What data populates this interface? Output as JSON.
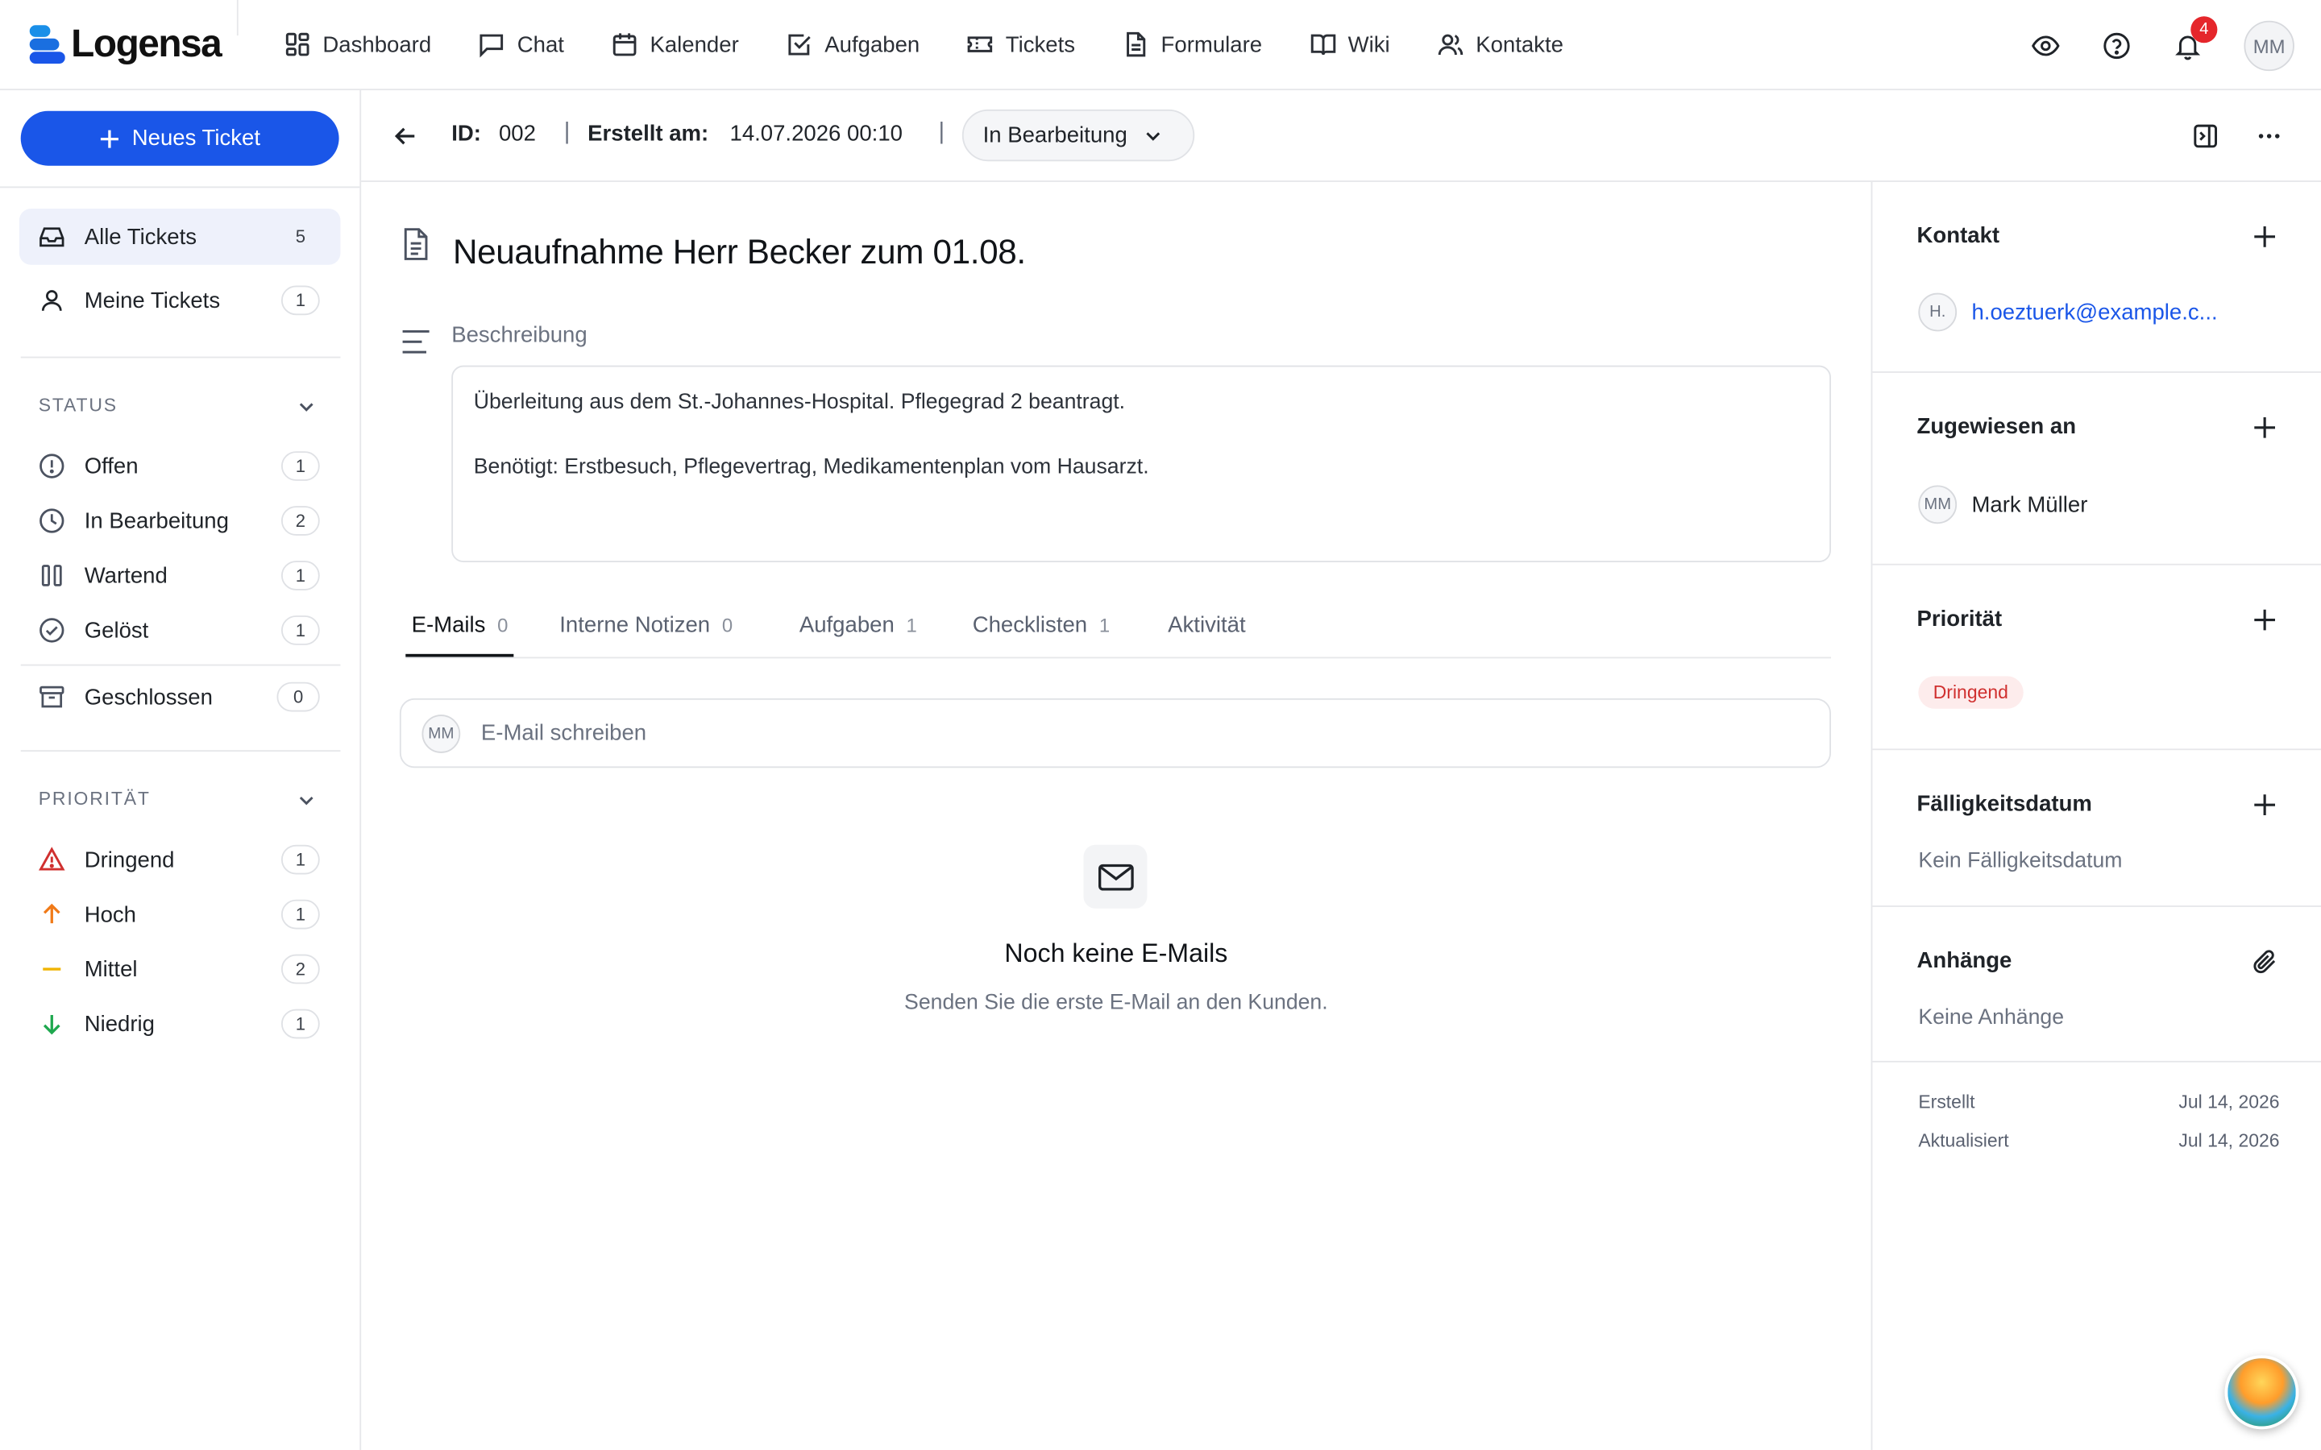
{
  "app": {
    "name": "Logensa"
  },
  "nav": {
    "items": [
      {
        "label": "Dashboard",
        "icon": "dashboard-icon"
      },
      {
        "label": "Chat",
        "icon": "chat-icon"
      },
      {
        "label": "Kalender",
        "icon": "calendar-icon"
      },
      {
        "label": "Aufgaben",
        "icon": "task-icon"
      },
      {
        "label": "Tickets",
        "icon": "ticket-icon"
      },
      {
        "label": "Formulare",
        "icon": "form-icon"
      },
      {
        "label": "Wiki",
        "icon": "book-icon"
      },
      {
        "label": "Kontakte",
        "icon": "contacts-icon"
      }
    ],
    "notification_count": "4",
    "user_initials": "MM"
  },
  "sidebar": {
    "new_ticket_label": "Neues Ticket",
    "views": [
      {
        "label": "Alle Tickets",
        "count": "5"
      },
      {
        "label": "Meine Tickets",
        "count": "1"
      }
    ],
    "status_section": "STATUS",
    "statuses": [
      {
        "label": "Offen",
        "count": "1"
      },
      {
        "label": "In Bearbeitung",
        "count": "2"
      },
      {
        "label": "Wartend",
        "count": "1"
      },
      {
        "label": "Gelöst",
        "count": "1"
      },
      {
        "label": "Geschlossen",
        "count": "0"
      }
    ],
    "priority_section": "PRIORITÄT",
    "priorities": [
      {
        "label": "Dringend",
        "count": "1",
        "color": "#d0302f"
      },
      {
        "label": "Hoch",
        "count": "1",
        "color": "#f07a18"
      },
      {
        "label": "Mittel",
        "count": "2",
        "color": "#f0b400"
      },
      {
        "label": "Niedrig",
        "count": "1",
        "color": "#1fa84f"
      }
    ]
  },
  "header": {
    "id_label": "ID:",
    "id_value": "002",
    "created_label": "Erstellt am:",
    "created_value": "14.07.2026 00:10",
    "status_value": "In Bearbeitung"
  },
  "ticket": {
    "title": "Neuaufnahme Herr Becker zum 01.08.",
    "description_label": "Beschreibung",
    "description_lines": [
      "Überleitung aus dem St.-Johannes-Hospital. Pflegegrad 2 beantragt.",
      "",
      "Benötigt: Erstbesuch, Pflegevertrag, Medikamentenplan vom Hausarzt."
    ]
  },
  "tabs": [
    {
      "label": "E-Mails",
      "count": "0"
    },
    {
      "label": "Interne Notizen",
      "count": "0"
    },
    {
      "label": "Aufgaben",
      "count": "1"
    },
    {
      "label": "Checklisten",
      "count": "1"
    },
    {
      "label": "Aktivität",
      "count": ""
    }
  ],
  "compose": {
    "avatar": "MM",
    "placeholder": "E-Mail schreiben"
  },
  "empty_state": {
    "title": "Noch keine E-Mails",
    "subtitle": "Senden Sie die erste E-Mail an den Kunden."
  },
  "right_panel": {
    "contact_title": "Kontakt",
    "contact_avatar": "H.",
    "contact_email": "h.oeztuerk@example.c...",
    "assigned_title": "Zugewiesen an",
    "assigned_avatar": "MM",
    "assigned_name": "Mark Müller",
    "priority_title": "Priorität",
    "priority_value": "Dringend",
    "due_title": "Fälligkeitsdatum",
    "due_value": "Kein Fälligkeitsdatum",
    "attachments_title": "Anhänge",
    "attachments_value": "Keine Anhänge",
    "created_label": "Erstellt",
    "created_value": "Jul 14, 2026",
    "updated_label": "Aktualisiert",
    "updated_value": "Jul 14, 2026"
  },
  "colors": {
    "accent": "#1a56e8",
    "urgent": "#d0302f",
    "badge": "#e5262b"
  }
}
